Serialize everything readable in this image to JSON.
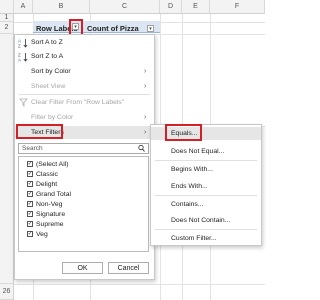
{
  "columns": [
    "A",
    "B",
    "C",
    "D",
    "E",
    "F"
  ],
  "rows": [
    "1",
    "2",
    "26"
  ],
  "pivot": {
    "row_labels": "Row Labels",
    "count_label": "Count of Pizza",
    "dropdown_glyph": "▾"
  },
  "menu": {
    "sort_az": "Sort A to Z",
    "sort_za": "Sort Z to A",
    "sort_by_color": "Sort by Color",
    "sheet_view": "Sheet View",
    "clear_filter": "Clear Filter From \"Row Labels\"",
    "filter_by_color": "Filter by Color",
    "text_filters": "Text Filters",
    "search_placeholder": "Search",
    "list": [
      "(Select All)",
      "Classic",
      "Delight",
      "Grand Total",
      "Non-Veg",
      "Signature",
      "Supreme",
      "Veg"
    ],
    "ok": "OK",
    "cancel": "Cancel"
  },
  "submenu": {
    "items": [
      "Equals...",
      "Does Not Equal...",
      "Begins With...",
      "Ends With...",
      "Contains...",
      "Does Not Contain...",
      "Custom Filter..."
    ]
  },
  "colors": {
    "highlight_border": "#d32027",
    "pivot_header": "#dce6f2",
    "selected_cell": "#1e7145"
  }
}
